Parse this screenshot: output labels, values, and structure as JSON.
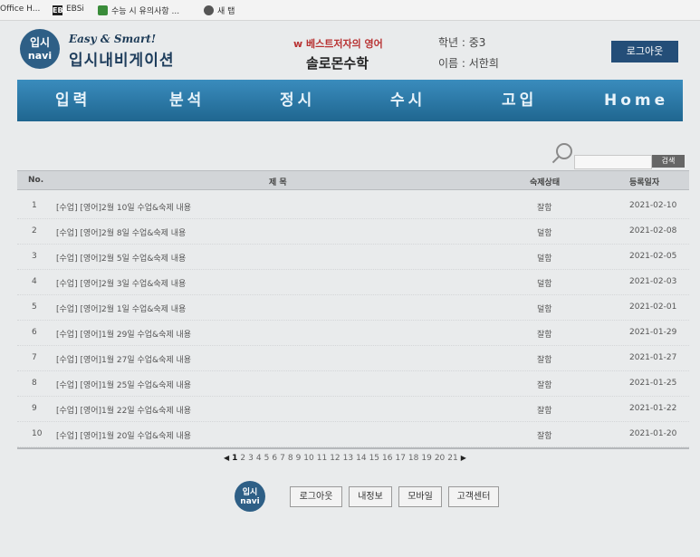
{
  "browser": {
    "bookmarks": [
      {
        "label": "Office H..."
      },
      {
        "icon": "EBS",
        "label": "EBSi"
      },
      {
        "label": "수능 시 유의사항 ..."
      },
      {
        "label": "새 탭"
      }
    ]
  },
  "header": {
    "logo_line1": "입시",
    "logo_line2": "navi",
    "tagline": "Easy & Smart!",
    "brand": "입시내비게이션",
    "academy_sub": "w 베스트저자의 영어",
    "academy_name": "솔로몬수학",
    "grade": "학년 : 중3",
    "student": "이름 : 서한희",
    "logout_label": "로그아웃"
  },
  "nav": {
    "items": [
      "입력",
      "분석",
      "정시",
      "수시",
      "고입",
      "Home"
    ]
  },
  "search": {
    "placeholder": "",
    "button_label": "검색"
  },
  "table": {
    "headers": {
      "no": "No.",
      "title": "제 목",
      "status": "숙제상태",
      "date": "등록일자"
    },
    "rows": [
      {
        "no": "1",
        "title": "[수업] [영어]2월 10일 수업&숙제 내용",
        "status": "잘함",
        "date": "2021-02-10"
      },
      {
        "no": "2",
        "title": "[수업] [영어]2월 8일 수업&숙제 내용",
        "status": "덜함",
        "date": "2021-02-08"
      },
      {
        "no": "3",
        "title": "[수업] [영어]2월 5일 수업&숙제 내용",
        "status": "덜함",
        "date": "2021-02-05"
      },
      {
        "no": "4",
        "title": "[수업] [영어]2월 3일 수업&숙제 내용",
        "status": "덜함",
        "date": "2021-02-03"
      },
      {
        "no": "5",
        "title": "[수업] [영어]2월 1일 수업&숙제 내용",
        "status": "덜함",
        "date": "2021-02-01"
      },
      {
        "no": "6",
        "title": "[수업] [영어]1월 29일 수업&숙제 내용",
        "status": "잘함",
        "date": "2021-01-29"
      },
      {
        "no": "7",
        "title": "[수업] [영어]1월 27일 수업&숙제 내용",
        "status": "잘함",
        "date": "2021-01-27"
      },
      {
        "no": "8",
        "title": "[수업] [영어]1월 25일 수업&숙제 내용",
        "status": "잘함",
        "date": "2021-01-25"
      },
      {
        "no": "9",
        "title": "[수업] [영어]1월 22일 수업&숙제 내용",
        "status": "잘함",
        "date": "2021-01-22"
      },
      {
        "no": "10",
        "title": "[수업] [영어]1월 20일 수업&숙제 내용",
        "status": "잘함",
        "date": "2021-01-20"
      }
    ]
  },
  "pagination": {
    "prev": "◀",
    "next": "▶",
    "current": "1",
    "pages": [
      "1",
      "2",
      "3",
      "4",
      "5",
      "6",
      "7",
      "8",
      "9",
      "10",
      "11",
      "12",
      "13",
      "14",
      "15",
      "16",
      "17",
      "18",
      "19",
      "20",
      "21"
    ]
  },
  "footer": {
    "logo_line1": "입시",
    "logo_line2": "navi",
    "buttons": [
      "로그아웃",
      "내정보",
      "모바일",
      "고객센터"
    ]
  }
}
